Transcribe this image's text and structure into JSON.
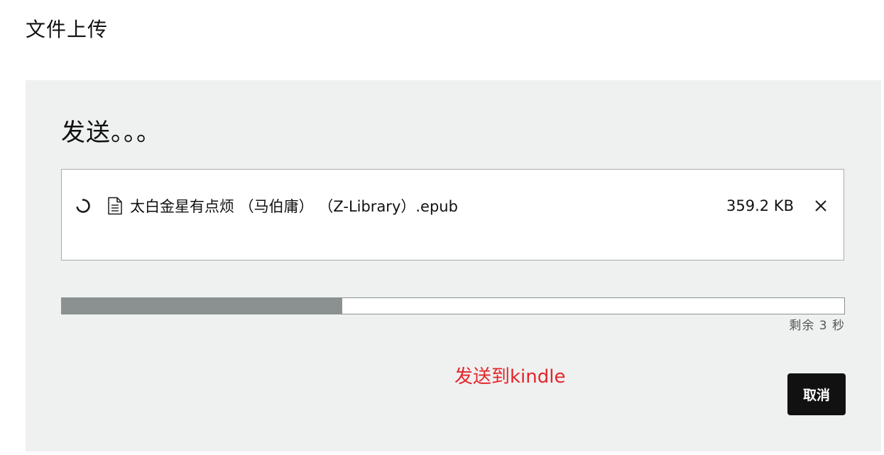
{
  "page": {
    "title": "文件上传"
  },
  "upload": {
    "status_heading": "发送。。。",
    "file": {
      "name": "太白金星有点烦 （马伯庸） （Z-Library）.epub",
      "size": "359.2 KB",
      "status_icon": "spinner-icon",
      "type_icon": "document-icon",
      "remove_icon": "close-icon"
    },
    "progress": {
      "fraction": 0.358,
      "remaining_text": "剩余 3 秒"
    },
    "send_to_label": "发送到kindle",
    "cancel_label": "取消"
  },
  "colors": {
    "panel_bg": "#eff0f0",
    "progress_fill": "#8b9090",
    "accent_red": "#e3262a",
    "button_bg": "#111111"
  }
}
